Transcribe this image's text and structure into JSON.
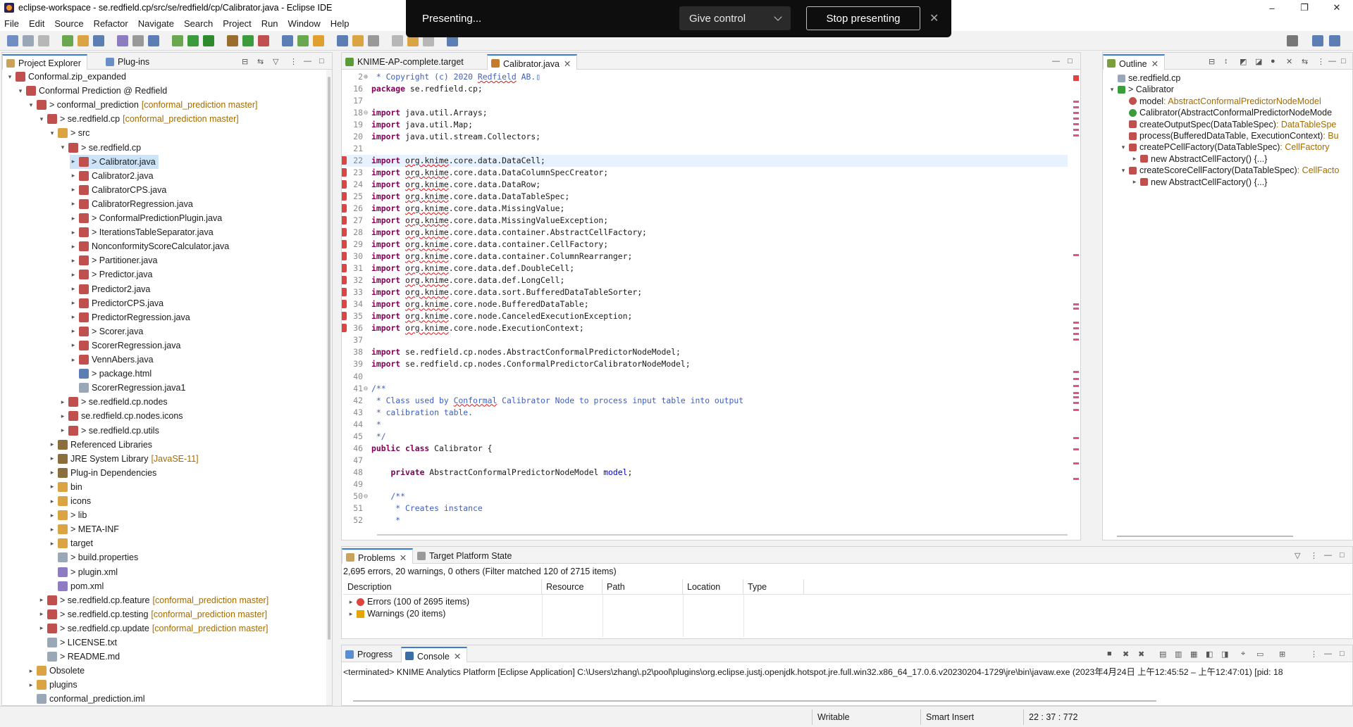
{
  "window": {
    "title": "eclipse-workspace - se.redfield.cp/src/se/redfield/cp/Calibrator.java - Eclipse IDE",
    "minimize": "–",
    "maximize": "❐",
    "close": "✕"
  },
  "menu": [
    "File",
    "Edit",
    "Source",
    "Refactor",
    "Navigate",
    "Search",
    "Project",
    "Run",
    "Window",
    "Help"
  ],
  "presenting": {
    "label": "Presenting...",
    "give_control": "Give control",
    "stop": "Stop presenting",
    "close": "✕"
  },
  "explorer": {
    "tabs": [
      {
        "label": "Project Explorer"
      },
      {
        "label": "Plug-ins"
      }
    ],
    "rows": [
      {
        "indent": 0,
        "arrow": "v",
        "icon": "project",
        "label": "Conformal.zip_expanded"
      },
      {
        "indent": 1,
        "arrow": "v",
        "icon": "project",
        "label": "Conformal Prediction @ Redfield"
      },
      {
        "indent": 2,
        "arrow": "v",
        "icon": "project",
        "label": "> conformal_prediction",
        "deco": "[conformal_prediction master]"
      },
      {
        "indent": 3,
        "arrow": "v",
        "icon": "project",
        "label": "> se.redfield.cp",
        "deco": "[conformal_prediction master]"
      },
      {
        "indent": 4,
        "arrow": "v",
        "icon": "folder",
        "label": "> src"
      },
      {
        "indent": 5,
        "arrow": "v",
        "icon": "package",
        "label": "> se.redfield.cp"
      },
      {
        "indent": 6,
        "arrow": ">",
        "icon": "java",
        "label": "> Calibrator.java",
        "selected": true
      },
      {
        "indent": 6,
        "arrow": ">",
        "icon": "java",
        "label": "Calibrator2.java"
      },
      {
        "indent": 6,
        "arrow": ">",
        "icon": "java",
        "label": "CalibratorCPS.java"
      },
      {
        "indent": 6,
        "arrow": ">",
        "icon": "java",
        "label": "CalibratorRegression.java"
      },
      {
        "indent": 6,
        "arrow": ">",
        "icon": "java",
        "label": "> ConformalPredictionPlugin.java"
      },
      {
        "indent": 6,
        "arrow": ">",
        "icon": "java",
        "label": "> IterationsTableSeparator.java"
      },
      {
        "indent": 6,
        "arrow": ">",
        "icon": "java",
        "label": "NonconformityScoreCalculator.java"
      },
      {
        "indent": 6,
        "arrow": ">",
        "icon": "java",
        "label": "> Partitioner.java"
      },
      {
        "indent": 6,
        "arrow": ">",
        "icon": "java",
        "label": "> Predictor.java"
      },
      {
        "indent": 6,
        "arrow": ">",
        "icon": "java",
        "label": "Predictor2.java"
      },
      {
        "indent": 6,
        "arrow": ">",
        "icon": "java",
        "label": "PredictorCPS.java"
      },
      {
        "indent": 6,
        "arrow": ">",
        "icon": "java",
        "label": "PredictorRegression.java"
      },
      {
        "indent": 6,
        "arrow": ">",
        "icon": "java",
        "label": "> Scorer.java"
      },
      {
        "indent": 6,
        "arrow": ">",
        "icon": "java",
        "label": "ScorerRegression.java"
      },
      {
        "indent": 6,
        "arrow": ">",
        "icon": "java",
        "label": "VennAbers.java"
      },
      {
        "indent": 6,
        "arrow": "",
        "icon": "html",
        "label": "> package.html"
      },
      {
        "indent": 6,
        "arrow": "",
        "icon": "file",
        "label": "ScorerRegression.java1"
      },
      {
        "indent": 5,
        "arrow": ">",
        "icon": "package",
        "label": "> se.redfield.cp.nodes"
      },
      {
        "indent": 5,
        "arrow": ">",
        "icon": "package",
        "label": "se.redfield.cp.nodes.icons"
      },
      {
        "indent": 5,
        "arrow": ">",
        "icon": "package",
        "label": "> se.redfield.cp.utils"
      },
      {
        "indent": 4,
        "arrow": ">",
        "icon": "lib",
        "label": "Referenced Libraries"
      },
      {
        "indent": 4,
        "arrow": ">",
        "icon": "lib",
        "label": "JRE System Library",
        "deco": "[JavaSE-11]"
      },
      {
        "indent": 4,
        "arrow": ">",
        "icon": "lib",
        "label": "Plug-in Dependencies"
      },
      {
        "indent": 4,
        "arrow": ">",
        "icon": "folder",
        "label": "bin"
      },
      {
        "indent": 4,
        "arrow": ">",
        "icon": "folder",
        "label": "icons"
      },
      {
        "indent": 4,
        "arrow": ">",
        "icon": "folder",
        "label": "> lib"
      },
      {
        "indent": 4,
        "arrow": ">",
        "icon": "folder",
        "label": "> META-INF"
      },
      {
        "indent": 4,
        "arrow": ">",
        "icon": "folder",
        "label": "target"
      },
      {
        "indent": 4,
        "arrow": "",
        "icon": "file",
        "label": "> build.properties"
      },
      {
        "indent": 4,
        "arrow": "",
        "icon": "xml",
        "label": "> plugin.xml"
      },
      {
        "indent": 4,
        "arrow": "",
        "icon": "xml",
        "label": "pom.xml"
      },
      {
        "indent": 3,
        "arrow": ">",
        "icon": "project",
        "label": "> se.redfield.cp.feature",
        "deco": "[conformal_prediction master]"
      },
      {
        "indent": 3,
        "arrow": ">",
        "icon": "project",
        "label": "> se.redfield.cp.testing",
        "deco": "[conformal_prediction master]"
      },
      {
        "indent": 3,
        "arrow": ">",
        "icon": "project",
        "label": "> se.redfield.cp.update",
        "deco": "[conformal_prediction master]"
      },
      {
        "indent": 3,
        "arrow": "",
        "icon": "file",
        "label": "> LICENSE.txt"
      },
      {
        "indent": 3,
        "arrow": "",
        "icon": "file",
        "label": "> README.md"
      },
      {
        "indent": 2,
        "arrow": ">",
        "icon": "folder",
        "label": "Obsolete"
      },
      {
        "indent": 2,
        "arrow": ">",
        "icon": "folder",
        "label": "plugins"
      },
      {
        "indent": 2,
        "arrow": "",
        "icon": "file",
        "label": "conformal_prediction.iml"
      }
    ]
  },
  "editor": {
    "tabs": [
      {
        "label": "KNIME-AP-complete.target"
      },
      {
        "label": "Calibrator.java",
        "close": "✕"
      }
    ],
    "lines": [
      {
        "n": "2",
        "fold": "⊕",
        "parts": [
          {
            "t": " * Copyright (c) 2020 ",
            "c": "cm"
          },
          {
            "t": "Redfield",
            "c": "cm err"
          },
          {
            "t": " AB.",
            "c": "cm"
          },
          {
            "t": "▯",
            "c": "cm"
          }
        ]
      },
      {
        "n": "16",
        "parts": [
          {
            "t": "package",
            "c": "kw"
          },
          {
            "t": " se.redfield.cp;"
          }
        ]
      },
      {
        "n": "17",
        "parts": []
      },
      {
        "n": "18",
        "fold": "⊖",
        "parts": [
          {
            "t": "import",
            "c": "kw"
          },
          {
            "t": " java.util.Arrays;"
          }
        ]
      },
      {
        "n": "19",
        "parts": [
          {
            "t": "import",
            "c": "kw"
          },
          {
            "t": " java.util.Map;"
          }
        ]
      },
      {
        "n": "20",
        "parts": [
          {
            "t": "import",
            "c": "kw"
          },
          {
            "t": " java.util.stream.Collectors;"
          }
        ]
      },
      {
        "n": "21",
        "parts": []
      },
      {
        "n": "22",
        "err": true,
        "hl": true,
        "parts": [
          {
            "t": "import",
            "c": "kw"
          },
          {
            "t": " "
          },
          {
            "t": "org.knime",
            "c": "err"
          },
          {
            "t": ".core.data.DataCell;"
          }
        ]
      },
      {
        "n": "23",
        "err": true,
        "parts": [
          {
            "t": "import",
            "c": "kw"
          },
          {
            "t": " "
          },
          {
            "t": "org.knime",
            "c": "err"
          },
          {
            "t": ".core.data.DataColumnSpecCreator;"
          }
        ]
      },
      {
        "n": "24",
        "err": true,
        "parts": [
          {
            "t": "import",
            "c": "kw"
          },
          {
            "t": " "
          },
          {
            "t": "org.knime",
            "c": "err"
          },
          {
            "t": ".core.data.DataRow;"
          }
        ]
      },
      {
        "n": "25",
        "err": true,
        "parts": [
          {
            "t": "import",
            "c": "kw"
          },
          {
            "t": " "
          },
          {
            "t": "org.knime",
            "c": "err"
          },
          {
            "t": ".core.data.DataTableSpec;"
          }
        ]
      },
      {
        "n": "26",
        "err": true,
        "parts": [
          {
            "t": "import",
            "c": "kw"
          },
          {
            "t": " "
          },
          {
            "t": "org.knime",
            "c": "err"
          },
          {
            "t": ".core.data.MissingValue;"
          }
        ]
      },
      {
        "n": "27",
        "err": true,
        "parts": [
          {
            "t": "import",
            "c": "kw"
          },
          {
            "t": " "
          },
          {
            "t": "org.knime",
            "c": "err"
          },
          {
            "t": ".core.data.MissingValueException;"
          }
        ]
      },
      {
        "n": "28",
        "err": true,
        "parts": [
          {
            "t": "import",
            "c": "kw"
          },
          {
            "t": " "
          },
          {
            "t": "org.knime",
            "c": "err"
          },
          {
            "t": ".core.data.container.AbstractCellFactory;"
          }
        ]
      },
      {
        "n": "29",
        "err": true,
        "parts": [
          {
            "t": "import",
            "c": "kw"
          },
          {
            "t": " "
          },
          {
            "t": "org.knime",
            "c": "err"
          },
          {
            "t": ".core.data.container.CellFactory;"
          }
        ]
      },
      {
        "n": "30",
        "err": true,
        "parts": [
          {
            "t": "import",
            "c": "kw"
          },
          {
            "t": " "
          },
          {
            "t": "org.knime",
            "c": "err"
          },
          {
            "t": ".core.data.container.ColumnRearranger;"
          }
        ]
      },
      {
        "n": "31",
        "err": true,
        "parts": [
          {
            "t": "import",
            "c": "kw"
          },
          {
            "t": " "
          },
          {
            "t": "org.knime",
            "c": "err"
          },
          {
            "t": ".core.data.def.DoubleCell;"
          }
        ]
      },
      {
        "n": "32",
        "err": true,
        "parts": [
          {
            "t": "import",
            "c": "kw"
          },
          {
            "t": " "
          },
          {
            "t": "org.knime",
            "c": "err"
          },
          {
            "t": ".core.data.def.LongCell;"
          }
        ]
      },
      {
        "n": "33",
        "err": true,
        "parts": [
          {
            "t": "import",
            "c": "kw"
          },
          {
            "t": " "
          },
          {
            "t": "org.knime",
            "c": "err"
          },
          {
            "t": ".core.data.sort.BufferedDataTableSorter;"
          }
        ]
      },
      {
        "n": "34",
        "err": true,
        "parts": [
          {
            "t": "import",
            "c": "kw"
          },
          {
            "t": " "
          },
          {
            "t": "org.knime",
            "c": "err"
          },
          {
            "t": ".core.node.BufferedDataTable;"
          }
        ]
      },
      {
        "n": "35",
        "err": true,
        "parts": [
          {
            "t": "import",
            "c": "kw"
          },
          {
            "t": " "
          },
          {
            "t": "org.knime",
            "c": "err"
          },
          {
            "t": ".core.node.CanceledExecutionException;"
          }
        ]
      },
      {
        "n": "36",
        "err": true,
        "parts": [
          {
            "t": "import",
            "c": "kw"
          },
          {
            "t": " "
          },
          {
            "t": "org.knime",
            "c": "err"
          },
          {
            "t": ".core.node.ExecutionContext;"
          }
        ]
      },
      {
        "n": "37",
        "parts": []
      },
      {
        "n": "38",
        "parts": [
          {
            "t": "import",
            "c": "kw"
          },
          {
            "t": " se.redfield.cp.nodes.AbstractConformalPredictorNodeModel;"
          }
        ]
      },
      {
        "n": "39",
        "parts": [
          {
            "t": "import",
            "c": "kw"
          },
          {
            "t": " se.redfield.cp.nodes.ConformalPredictorCalibratorNodeModel;"
          }
        ]
      },
      {
        "n": "40",
        "parts": []
      },
      {
        "n": "41",
        "fold": "⊖",
        "parts": [
          {
            "t": "/**",
            "c": "cm"
          }
        ]
      },
      {
        "n": "42",
        "parts": [
          {
            "t": " * Class used by ",
            "c": "cm"
          },
          {
            "t": "Conformal",
            "c": "cm err"
          },
          {
            "t": " Calibrator Node to process input table into output",
            "c": "cm"
          }
        ]
      },
      {
        "n": "43",
        "parts": [
          {
            "t": " * calibration table.",
            "c": "cm"
          }
        ]
      },
      {
        "n": "44",
        "parts": [
          {
            "t": " *",
            "c": "cm"
          }
        ]
      },
      {
        "n": "45",
        "parts": [
          {
            "t": " */",
            "c": "cm"
          }
        ]
      },
      {
        "n": "46",
        "parts": [
          {
            "t": "public class",
            "c": "kw"
          },
          {
            "t": " Calibrator {"
          }
        ]
      },
      {
        "n": "47",
        "parts": []
      },
      {
        "n": "48",
        "parts": [
          {
            "t": "    "
          },
          {
            "t": "private",
            "c": "kw"
          },
          {
            "t": " AbstractConformalPredictorNodeModel "
          },
          {
            "t": "model",
            "c": "fld"
          },
          {
            "t": ";"
          }
        ]
      },
      {
        "n": "49",
        "parts": []
      },
      {
        "n": "50",
        "fold": "⊖",
        "parts": [
          {
            "t": "    /**",
            "c": "cm"
          }
        ]
      },
      {
        "n": "51",
        "parts": [
          {
            "t": "     * Creates instance",
            "c": "cm"
          }
        ]
      },
      {
        "n": "52",
        "parts": [
          {
            "t": "     *",
            "c": "cm"
          }
        ]
      }
    ]
  },
  "outline": {
    "tab": "Outline",
    "close": "✕",
    "rows": [
      {
        "indent": 0,
        "arrow": "",
        "icon": "pkg",
        "label": "se.redfield.cp"
      },
      {
        "indent": 0,
        "arrow": "v",
        "icon": "class",
        "label": "> Calibrator"
      },
      {
        "indent": 1,
        "arrow": "",
        "icon": "field",
        "label": "model",
        "ret": " : AbstractConformalPredictorNodeModel"
      },
      {
        "indent": 1,
        "arrow": "",
        "icon": "ctor",
        "label": "Calibrator(AbstractConformalPredictorNodeMode"
      },
      {
        "indent": 1,
        "arrow": "",
        "icon": "method",
        "label": "createOutputSpec(DataTableSpec)",
        "ret": " : DataTableSpe"
      },
      {
        "indent": 1,
        "arrow": "",
        "icon": "method",
        "label": "process(BufferedDataTable, ExecutionContext)",
        "ret": " : Bu"
      },
      {
        "indent": 1,
        "arrow": "v",
        "icon": "method",
        "label": "createPCellFactory(DataTableSpec)",
        "ret": " : CellFactory"
      },
      {
        "indent": 2,
        "arrow": ">",
        "icon": "anon",
        "label": "new AbstractCellFactory() {...}"
      },
      {
        "indent": 1,
        "arrow": "v",
        "icon": "method",
        "label": "createScoreCellFactory(DataTableSpec)",
        "ret": " : CellFacto"
      },
      {
        "indent": 2,
        "arrow": ">",
        "icon": "anon",
        "label": "new AbstractCellFactory() {...}"
      }
    ]
  },
  "problems": {
    "tabs": [
      {
        "label": "Problems",
        "close": "✕"
      },
      {
        "label": "Target Platform State"
      }
    ],
    "summary": "2,695 errors, 20 warnings, 0 others (Filter matched 120 of 2715 items)",
    "columns": [
      "Description",
      "Resource",
      "Path",
      "Location",
      "Type"
    ],
    "rows": [
      {
        "icon": "error",
        "label": "Errors (100 of 2695 items)"
      },
      {
        "icon": "warning",
        "label": "Warnings (20 items)"
      }
    ]
  },
  "console": {
    "tabs": [
      {
        "label": "Progress"
      },
      {
        "label": "Console",
        "close": "✕"
      }
    ],
    "text": "<terminated> KNIME Analytics Platform [Eclipse Application] C:\\Users\\zhang\\.p2\\pool\\plugins\\org.eclipse.justj.openjdk.hotspot.jre.full.win32.x86_64_17.0.6.v20230204-1729\\jre\\bin\\javaw.exe  (2023年4月24日 上午12:45:52 – 上午12:47:01) [pid: 18"
  },
  "status": {
    "writable": "Writable",
    "insert": "Smart Insert",
    "position": "22 : 37 : 772"
  },
  "colors": {
    "error": "#d44",
    "warning": "#e8a400",
    "accent": "#3a7bd5",
    "keyword": "#7f0055",
    "comment": "#3f5fbf",
    "decoration": "#a66b00"
  }
}
